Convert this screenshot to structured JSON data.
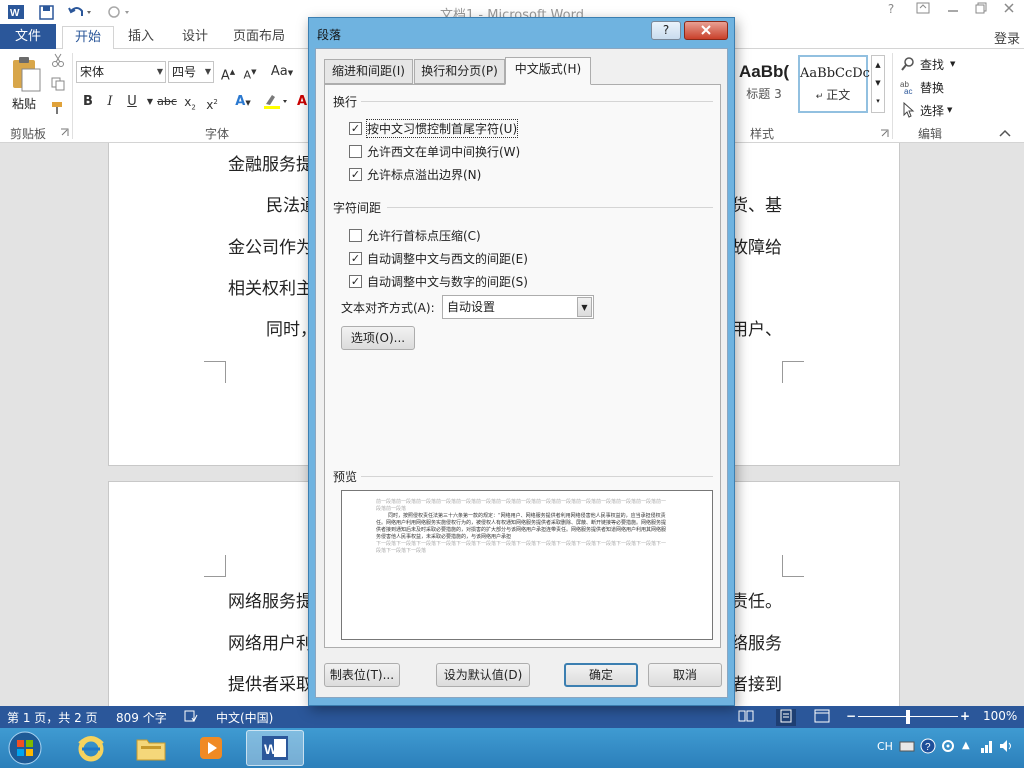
{
  "window": {
    "title": "文档1 - Microsoft Word",
    "help": "?",
    "login": "登录"
  },
  "ribbon": {
    "tabs": [
      "文件",
      "开始",
      "插入",
      "设计",
      "页面布局"
    ],
    "clipboard": {
      "paste": "粘贴",
      "group": "剪贴板"
    },
    "font": {
      "name": "宋体",
      "size": "四号",
      "group": "字体",
      "aa": "Aa"
    },
    "styles": {
      "style1_preview": "AaBb(",
      "style1_name": "标题 3",
      "style2_preview": "AaBbCcDc",
      "style2_name": "正文",
      "group": "样式"
    },
    "editing": {
      "find": "查找",
      "replace": "替换",
      "select": "选择",
      "group": "编辑"
    }
  },
  "document": {
    "page1": {
      "line1": "金融服务提",
      "line2_left": "民法通",
      "line2_right": "货、基",
      "line3_left": "金公司作为",
      "line3_right": "故障给",
      "line4_left": "相关权利主",
      "line5_left": "同时，",
      "line5_right": "用户、"
    },
    "page2": {
      "line1_left": "网络服务提",
      "line1_right": "责任。",
      "line2_left": "网络用户利",
      "line2_right": "络服务",
      "line3_left": "提供者采取",
      "line3_right": "者接到"
    }
  },
  "statusbar": {
    "page": "第 1 页，共 2 页",
    "words": "809 个字",
    "language": "中文(中国)",
    "zoom": "100%",
    "zoom_level": 0.5
  },
  "taskbar": {
    "tray_lang": "CH"
  },
  "dialog": {
    "title": "段落",
    "tabs": [
      "缩进和间距(I)",
      "换行和分页(P)",
      "中文版式(H)"
    ],
    "active_tab": 2,
    "section_wrap": "换行",
    "wrap_options": [
      {
        "label": "按中文习惯控制首尾字符(U)",
        "checked": true
      },
      {
        "label": "允许西文在单词中间换行(W)",
        "checked": false
      },
      {
        "label": "允许标点溢出边界(N)",
        "checked": true
      }
    ],
    "section_spacing": "字符间距",
    "spacing_options": [
      {
        "label": "允许行首标点压缩(C)",
        "checked": false
      },
      {
        "label": "自动调整中文与西文的间距(E)",
        "checked": true
      },
      {
        "label": "自动调整中文与数字的间距(S)",
        "checked": true
      }
    ],
    "text_align_label": "文本对齐方式(A):",
    "text_align_value": "自动设置",
    "options_button": "选项(O)...",
    "preview_title": "预览",
    "preview_prev": "前一段落前一段落前一段落前一段落前一段落前一段落前一段落前一段落前一段落前一段落前一段落前一段落前一段落前一段落前一段落前一段落",
    "preview_text": "同时，按照侵权责任法第三十六条第一款的规定：“网络用户、网络服务提供者利用网络侵害他人民事权益的，应当承担侵权责任。网络用户利用网络服务实施侵权行为的，被侵权人有权通知网络服务提供者采取删除、屏蔽、断开链接等必要措施。网络服务提供者接到通知后未及时采取必要措施的，对损害的扩大部分与该网络用户承担连带责任。网络服务提供者知道网络用户利用其网络服务侵害他人民事权益，未采取必要措施的，与该网络用户承担",
    "preview_next": "下一段落下一段落下一段落下一段落下一段落下一段落下一段落下一段落下一段落下一段落下一段落下一段落下一段落下一段落下一段落下一段落下一段落",
    "buttons": {
      "tabs": "制表位(T)...",
      "default": "设为默认值(D)",
      "ok": "确定",
      "cancel": "取消"
    }
  }
}
